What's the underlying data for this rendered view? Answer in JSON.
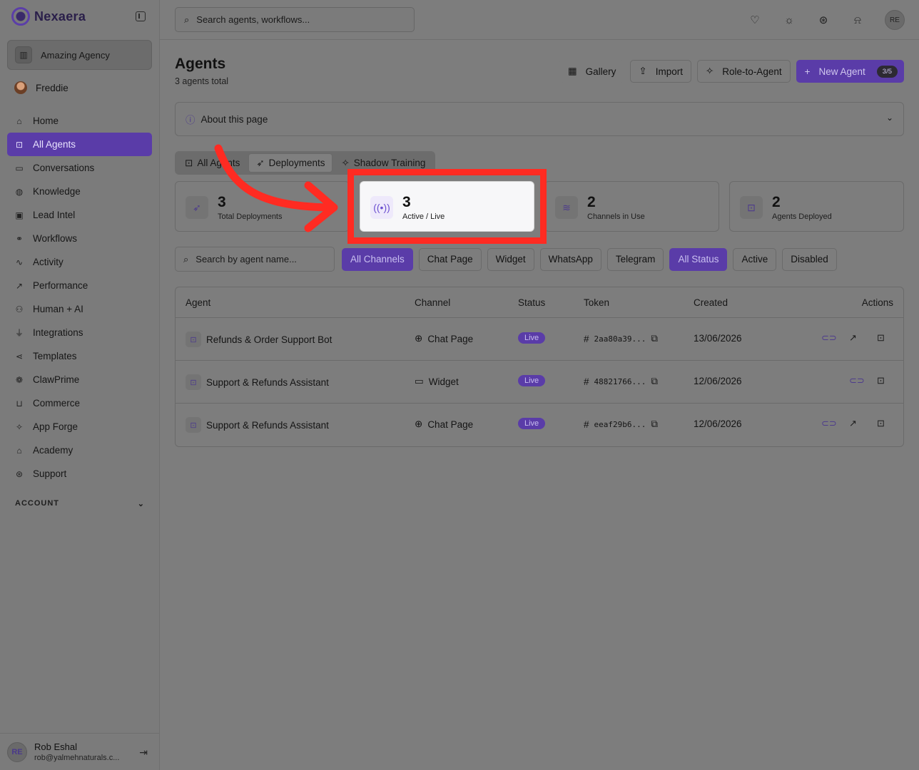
{
  "app": {
    "brand": "Nexaera",
    "accent": "#5a3ca8",
    "callout_color": "#ff2b22"
  },
  "sidebar": {
    "org_name": "Amazing Agency",
    "user_name": "Freddie",
    "items": [
      {
        "label": "Home",
        "icon": "home-icon"
      },
      {
        "label": "All Agents",
        "icon": "bot-icon",
        "active": true
      },
      {
        "label": "Conversations",
        "icon": "chat-icon"
      },
      {
        "label": "Knowledge",
        "icon": "brain-icon"
      },
      {
        "label": "Lead Intel",
        "icon": "contact-icon"
      },
      {
        "label": "Workflows",
        "icon": "workflow-icon"
      },
      {
        "label": "Activity",
        "icon": "activity-icon"
      },
      {
        "label": "Performance",
        "icon": "trend-icon"
      },
      {
        "label": "Human + AI",
        "icon": "network-icon"
      },
      {
        "label": "Integrations",
        "icon": "plug-icon"
      },
      {
        "label": "Templates",
        "icon": "share-icon"
      },
      {
        "label": "ClawPrime",
        "icon": "paw-icon"
      },
      {
        "label": "Commerce",
        "icon": "cart-icon"
      },
      {
        "label": "App Forge",
        "icon": "sparkles-icon"
      },
      {
        "label": "Academy",
        "icon": "graduation-icon"
      },
      {
        "label": "Support",
        "icon": "lifebuoy-icon"
      }
    ],
    "account_label": "ACCOUNT",
    "footer": {
      "initials": "RE",
      "name": "Rob Eshal",
      "email": "rob@yalmehnaturals.c..."
    }
  },
  "topbar": {
    "search_placeholder": "Search agents, workflows...",
    "avatar_initials": "RE"
  },
  "page": {
    "title": "Agents",
    "subtitle": "3 agents total",
    "buttons": {
      "gallery": "Gallery",
      "import": "Import",
      "role_to_agent": "Role-to-Agent",
      "new_agent": "New Agent",
      "new_agent_count": "3/5"
    },
    "about": "About this page",
    "tabs": [
      "All Agents",
      "Deployments",
      "Shadow Training"
    ]
  },
  "stats": [
    {
      "value": "3",
      "label": "Total Deployments"
    },
    {
      "value": "3",
      "label": "Active / Live"
    },
    {
      "value": "2",
      "label": "Channels in Use"
    },
    {
      "value": "2",
      "label": "Agents Deployed"
    }
  ],
  "filters": {
    "search_placeholder": "Search by agent name...",
    "channels": [
      "All Channels",
      "Chat Page",
      "Widget",
      "WhatsApp",
      "Telegram"
    ],
    "statuses": [
      "All Status",
      "Active",
      "Disabled"
    ]
  },
  "table": {
    "headers": [
      "Agent",
      "Channel",
      "Status",
      "Token",
      "Created",
      "Actions"
    ],
    "rows": [
      {
        "agent": "Refunds & Order Support Bot",
        "channel": "Chat Page",
        "status": "Live",
        "token": "2aa80a39...",
        "created": "13/06/2026"
      },
      {
        "agent": "Support & Refunds Assistant",
        "channel": "Widget",
        "status": "Live",
        "token": "48821766...",
        "created": "12/06/2026"
      },
      {
        "agent": "Support & Refunds Assistant",
        "channel": "Chat Page",
        "status": "Live",
        "token": "eeaf29b6...",
        "created": "12/06/2026"
      }
    ]
  }
}
